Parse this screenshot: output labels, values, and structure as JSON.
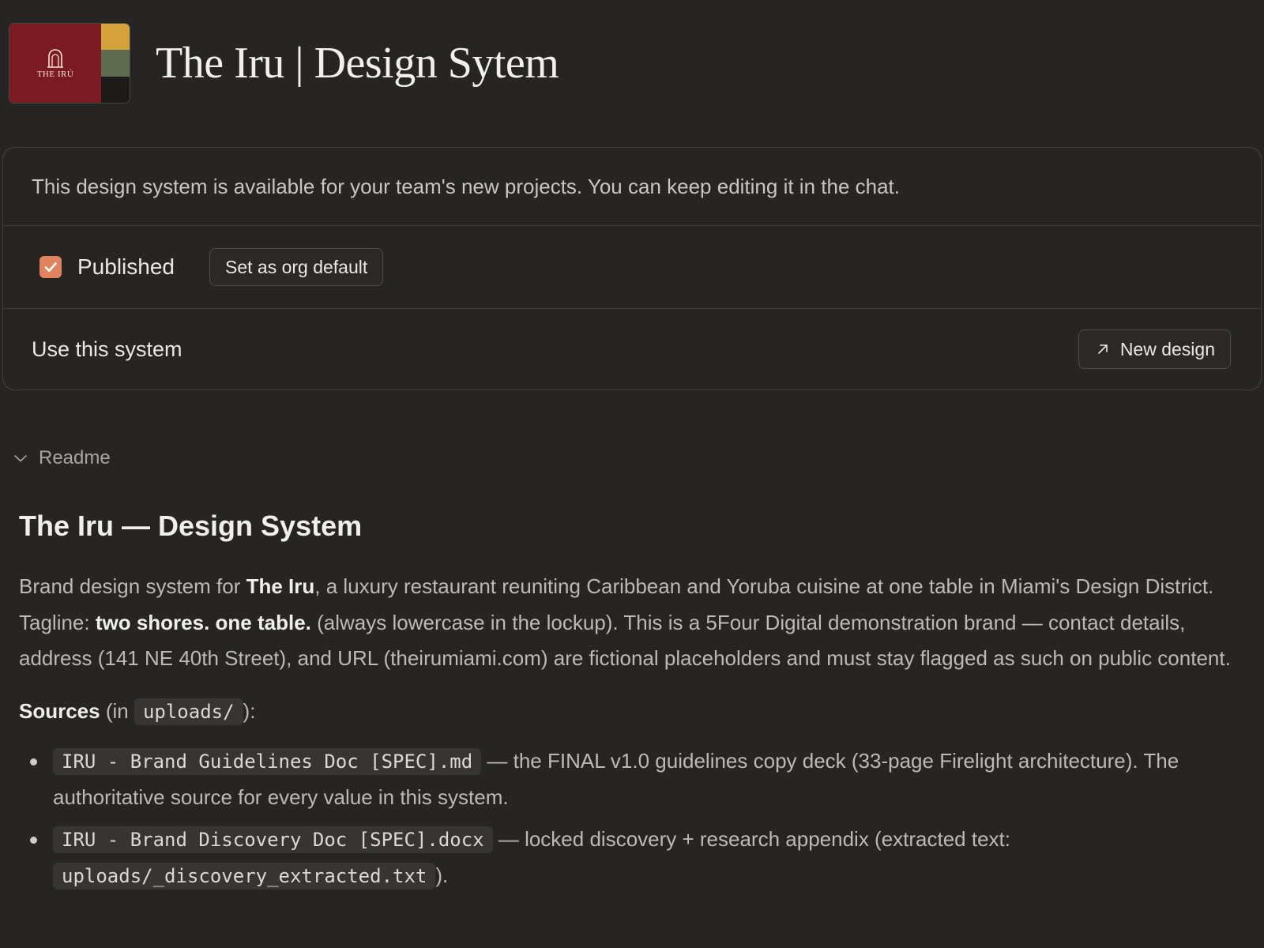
{
  "header": {
    "title": "The Iru | Design Sytem",
    "logo": {
      "wordmark": "THE IRÚ",
      "icon": "arch-icon",
      "colors": {
        "primary": "#7c1a24",
        "swatches": [
          "#d4a23a",
          "#5d6a4f",
          "#1c1b1a"
        ]
      }
    }
  },
  "card": {
    "info": "This design system is available for your team's new projects. You can keep editing it in the chat.",
    "published": {
      "label": "Published",
      "checked": true,
      "accent": "#e0835f"
    },
    "org_default_button": "Set as org default",
    "use_label": "Use this system",
    "new_design_button": "New design",
    "new_design_icon": "arrow-up-right-icon"
  },
  "readme": {
    "toggle_label": "Readme",
    "toggle_icon": "chevron-down-icon",
    "title": "The Iru — Design System",
    "intro": {
      "t1": "Brand design system for ",
      "b1": "The Iru",
      "t2": ", a luxury restaurant reuniting Caribbean and Yoruba cuisine at one table in Miami's Design District. Tagline: ",
      "b2": "two shores. one table.",
      "t3": " (always lowercase in the lockup). This is a 5Four Digital demonstration brand — contact details, address (141 NE 40th Street), and URL (theirumiami.com) are fictional placeholders and must stay flagged as such on public content."
    },
    "sources": {
      "label": "Sources",
      "pre": " (in ",
      "folder": "uploads/",
      "post": "):"
    },
    "source_items": [
      {
        "file": "IRU - Brand Guidelines Doc [SPEC].md",
        "desc": " — the FINAL v1.0 guidelines copy deck (33-page Firelight architecture). The authoritative source for every value in this system."
      },
      {
        "file": "IRU - Brand Discovery Doc [SPEC].docx",
        "desc": " — locked discovery + research appendix (extracted text: ",
        "file2": "uploads/_discovery_extracted.txt",
        "desc2": ")."
      }
    ]
  }
}
